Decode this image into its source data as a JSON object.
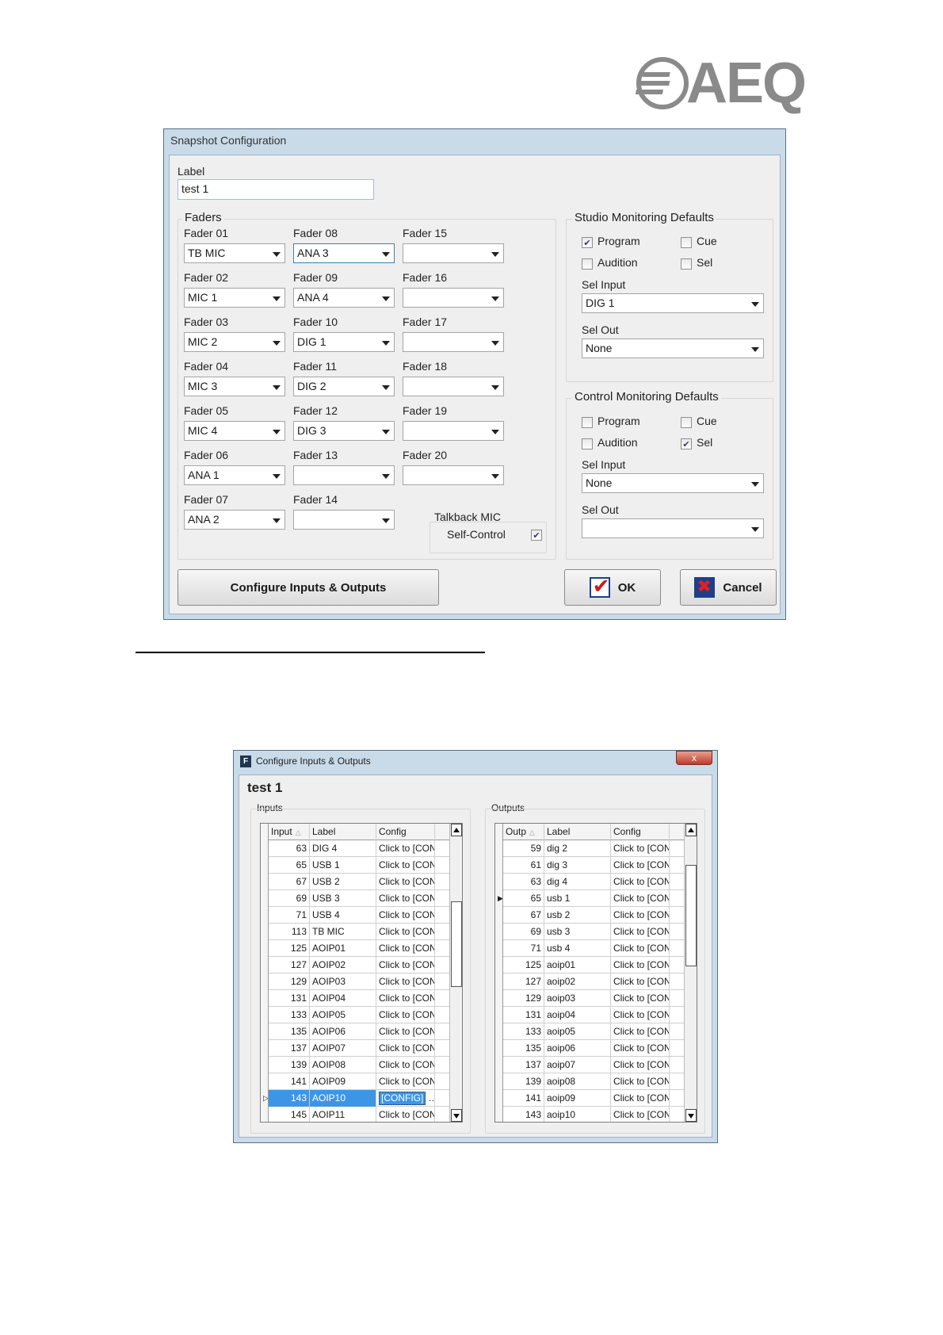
{
  "logo": {
    "text": "AEQ"
  },
  "snapshot": {
    "title": "Snapshot Configuration",
    "label_caption": "Label",
    "label_value": "test 1",
    "faders_title": "Faders",
    "faders": [
      {
        "name": "Fader 01",
        "value": "TB MIC"
      },
      {
        "name": "Fader 02",
        "value": "MIC 1"
      },
      {
        "name": "Fader 03",
        "value": "MIC 2"
      },
      {
        "name": "Fader 04",
        "value": "MIC 3"
      },
      {
        "name": "Fader 05",
        "value": "MIC 4"
      },
      {
        "name": "Fader 06",
        "value": "ANA 1"
      },
      {
        "name": "Fader 07",
        "value": "ANA 2"
      },
      {
        "name": "Fader 08",
        "value": "ANA 3"
      },
      {
        "name": "Fader 09",
        "value": "ANA 4"
      },
      {
        "name": "Fader 10",
        "value": "DIG 1"
      },
      {
        "name": "Fader 11",
        "value": "DIG 2"
      },
      {
        "name": "Fader 12",
        "value": "DIG 3"
      },
      {
        "name": "Fader 13",
        "value": ""
      },
      {
        "name": "Fader 14",
        "value": ""
      },
      {
        "name": "Fader 15",
        "value": ""
      },
      {
        "name": "Fader 16",
        "value": ""
      },
      {
        "name": "Fader 17",
        "value": ""
      },
      {
        "name": "Fader 18",
        "value": ""
      },
      {
        "name": "Fader 19",
        "value": ""
      },
      {
        "name": "Fader 20",
        "value": ""
      }
    ],
    "talkback": {
      "title": "Talkback MIC",
      "self_control": "Self-Control",
      "checked": true
    },
    "studio": {
      "title": "Studio Monitoring Defaults",
      "program": "Program",
      "program_checked": true,
      "cue": "Cue",
      "cue_checked": false,
      "audition": "Audition",
      "audition_checked": false,
      "sel": "Sel",
      "sel_checked": false,
      "sel_input_label": "Sel Input",
      "sel_input": "DIG 1",
      "sel_out_label": "Sel Out",
      "sel_out": "None"
    },
    "control": {
      "title": "Control Monitoring Defaults",
      "program": "Program",
      "program_checked": false,
      "cue": "Cue",
      "cue_checked": false,
      "audition": "Audition",
      "audition_checked": false,
      "sel": "Sel",
      "sel_checked": true,
      "sel_input_label": "Sel Input",
      "sel_input": "None",
      "sel_out_label": "Sel Out",
      "sel_out": ""
    },
    "buttons": {
      "configure": "Configure Inputs & Outputs",
      "ok": "OK",
      "cancel": "Cancel"
    }
  },
  "configure_io": {
    "window_title": "Configure Inputs & Outputs",
    "app_icon": "F",
    "close_glyph": "x",
    "heading": "test 1",
    "inputs": {
      "title": "Inputs",
      "columns": [
        "Input",
        "Label",
        "Config"
      ],
      "rows": [
        [
          "63",
          "DIG 4",
          "Click to [CON"
        ],
        [
          "65",
          "USB 1",
          "Click to [CON"
        ],
        [
          "67",
          "USB 2",
          "Click to [CON"
        ],
        [
          "69",
          "USB 3",
          "Click to [CON"
        ],
        [
          "71",
          "USB 4",
          "Click to [CON"
        ],
        [
          "113",
          "TB MIC",
          "Click to [CON"
        ],
        [
          "125",
          "AOIP01",
          "Click to [CON"
        ],
        [
          "127",
          "AOIP02",
          "Click to [CON"
        ],
        [
          "129",
          "AOIP03",
          "Click to [CON"
        ],
        [
          "131",
          "AOIP04",
          "Click to [CON"
        ],
        [
          "133",
          "AOIP05",
          "Click to [CON"
        ],
        [
          "135",
          "AOIP06",
          "Click to [CON"
        ],
        [
          "137",
          "AOIP07",
          "Click to [CON"
        ],
        [
          "139",
          "AOIP08",
          "Click to [CON"
        ],
        [
          "141",
          "AOIP09",
          "Click to [CON"
        ],
        [
          "143",
          "AOIP10",
          "[CONFIG]"
        ],
        [
          "145",
          "AOIP11",
          "Click to [CON"
        ]
      ],
      "selected_row": 15,
      "edit_ellipsis": "…"
    },
    "outputs": {
      "title": "Outputs",
      "columns": [
        "Outp",
        "Label",
        "Config"
      ],
      "rows": [
        [
          "59",
          "dig 2",
          "Click to [CONI"
        ],
        [
          "61",
          "dig 3",
          "Click to [CONI"
        ],
        [
          "63",
          "dig 4",
          "Click to [CONI"
        ],
        [
          "65",
          "usb 1",
          "Click to [CONI"
        ],
        [
          "67",
          "usb 2",
          "Click to [CONI"
        ],
        [
          "69",
          "usb 3",
          "Click to [CONI"
        ],
        [
          "71",
          "usb 4",
          "Click to [CONI"
        ],
        [
          "125",
          "aoip01",
          "Click to [CONI"
        ],
        [
          "127",
          "aoip02",
          "Click to [CONI"
        ],
        [
          "129",
          "aoip03",
          "Click to [CONI"
        ],
        [
          "131",
          "aoip04",
          "Click to [CONI"
        ],
        [
          "133",
          "aoip05",
          "Click to [CONI"
        ],
        [
          "135",
          "aoip06",
          "Click to [CONI"
        ],
        [
          "137",
          "aoip07",
          "Click to [CONI"
        ],
        [
          "139",
          "aoip08",
          "Click to [CONI"
        ],
        [
          "141",
          "aoip09",
          "Click to [CONI"
        ],
        [
          "143",
          "aoip10",
          "Click to [CONI"
        ]
      ],
      "current_row": 3
    }
  }
}
